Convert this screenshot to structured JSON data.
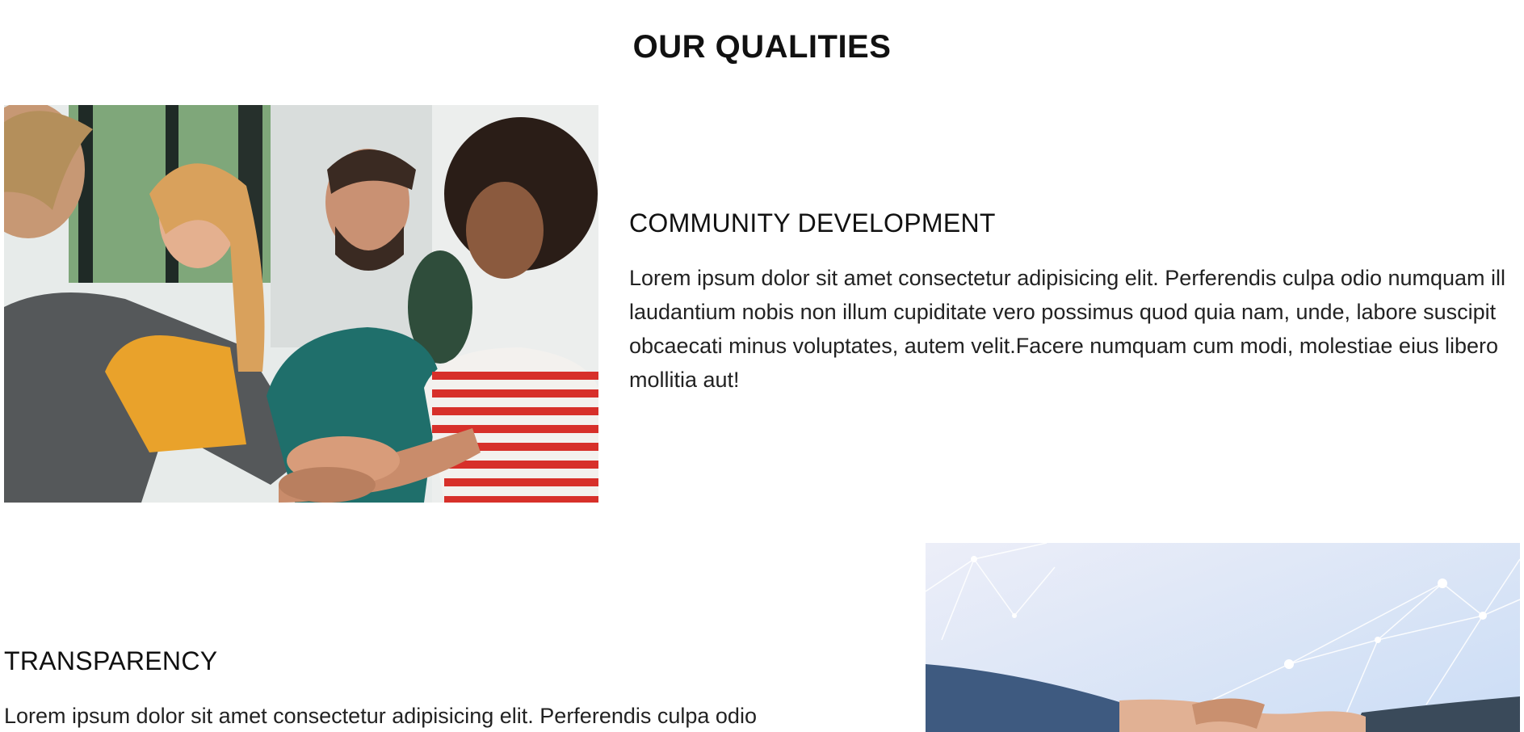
{
  "section": {
    "title": "OUR QUALITIES"
  },
  "qualities": [
    {
      "heading": "COMMUNITY DEVELOPMENT",
      "body": "Lorem ipsum dolor sit amet consectetur adipisicing elit. Perferendis culpa odio numquam ill laudantium nobis non illum cupiditate vero possimus quod quia nam, unde, labore suscipit obcaecati minus voluptates, autem velit.Facere numquam cum modi, molestiae eius libero mollitia aut!",
      "image": "team-hands-together-photo"
    },
    {
      "heading": "TRANSPARENCY",
      "body": "Lorem ipsum dolor sit amet consectetur adipisicing elit. Perferendis culpa odio",
      "image": "handshake-network-photo"
    }
  ],
  "colors": {
    "background": "#ffffff",
    "text": "#111111",
    "body_text": "#222222"
  }
}
